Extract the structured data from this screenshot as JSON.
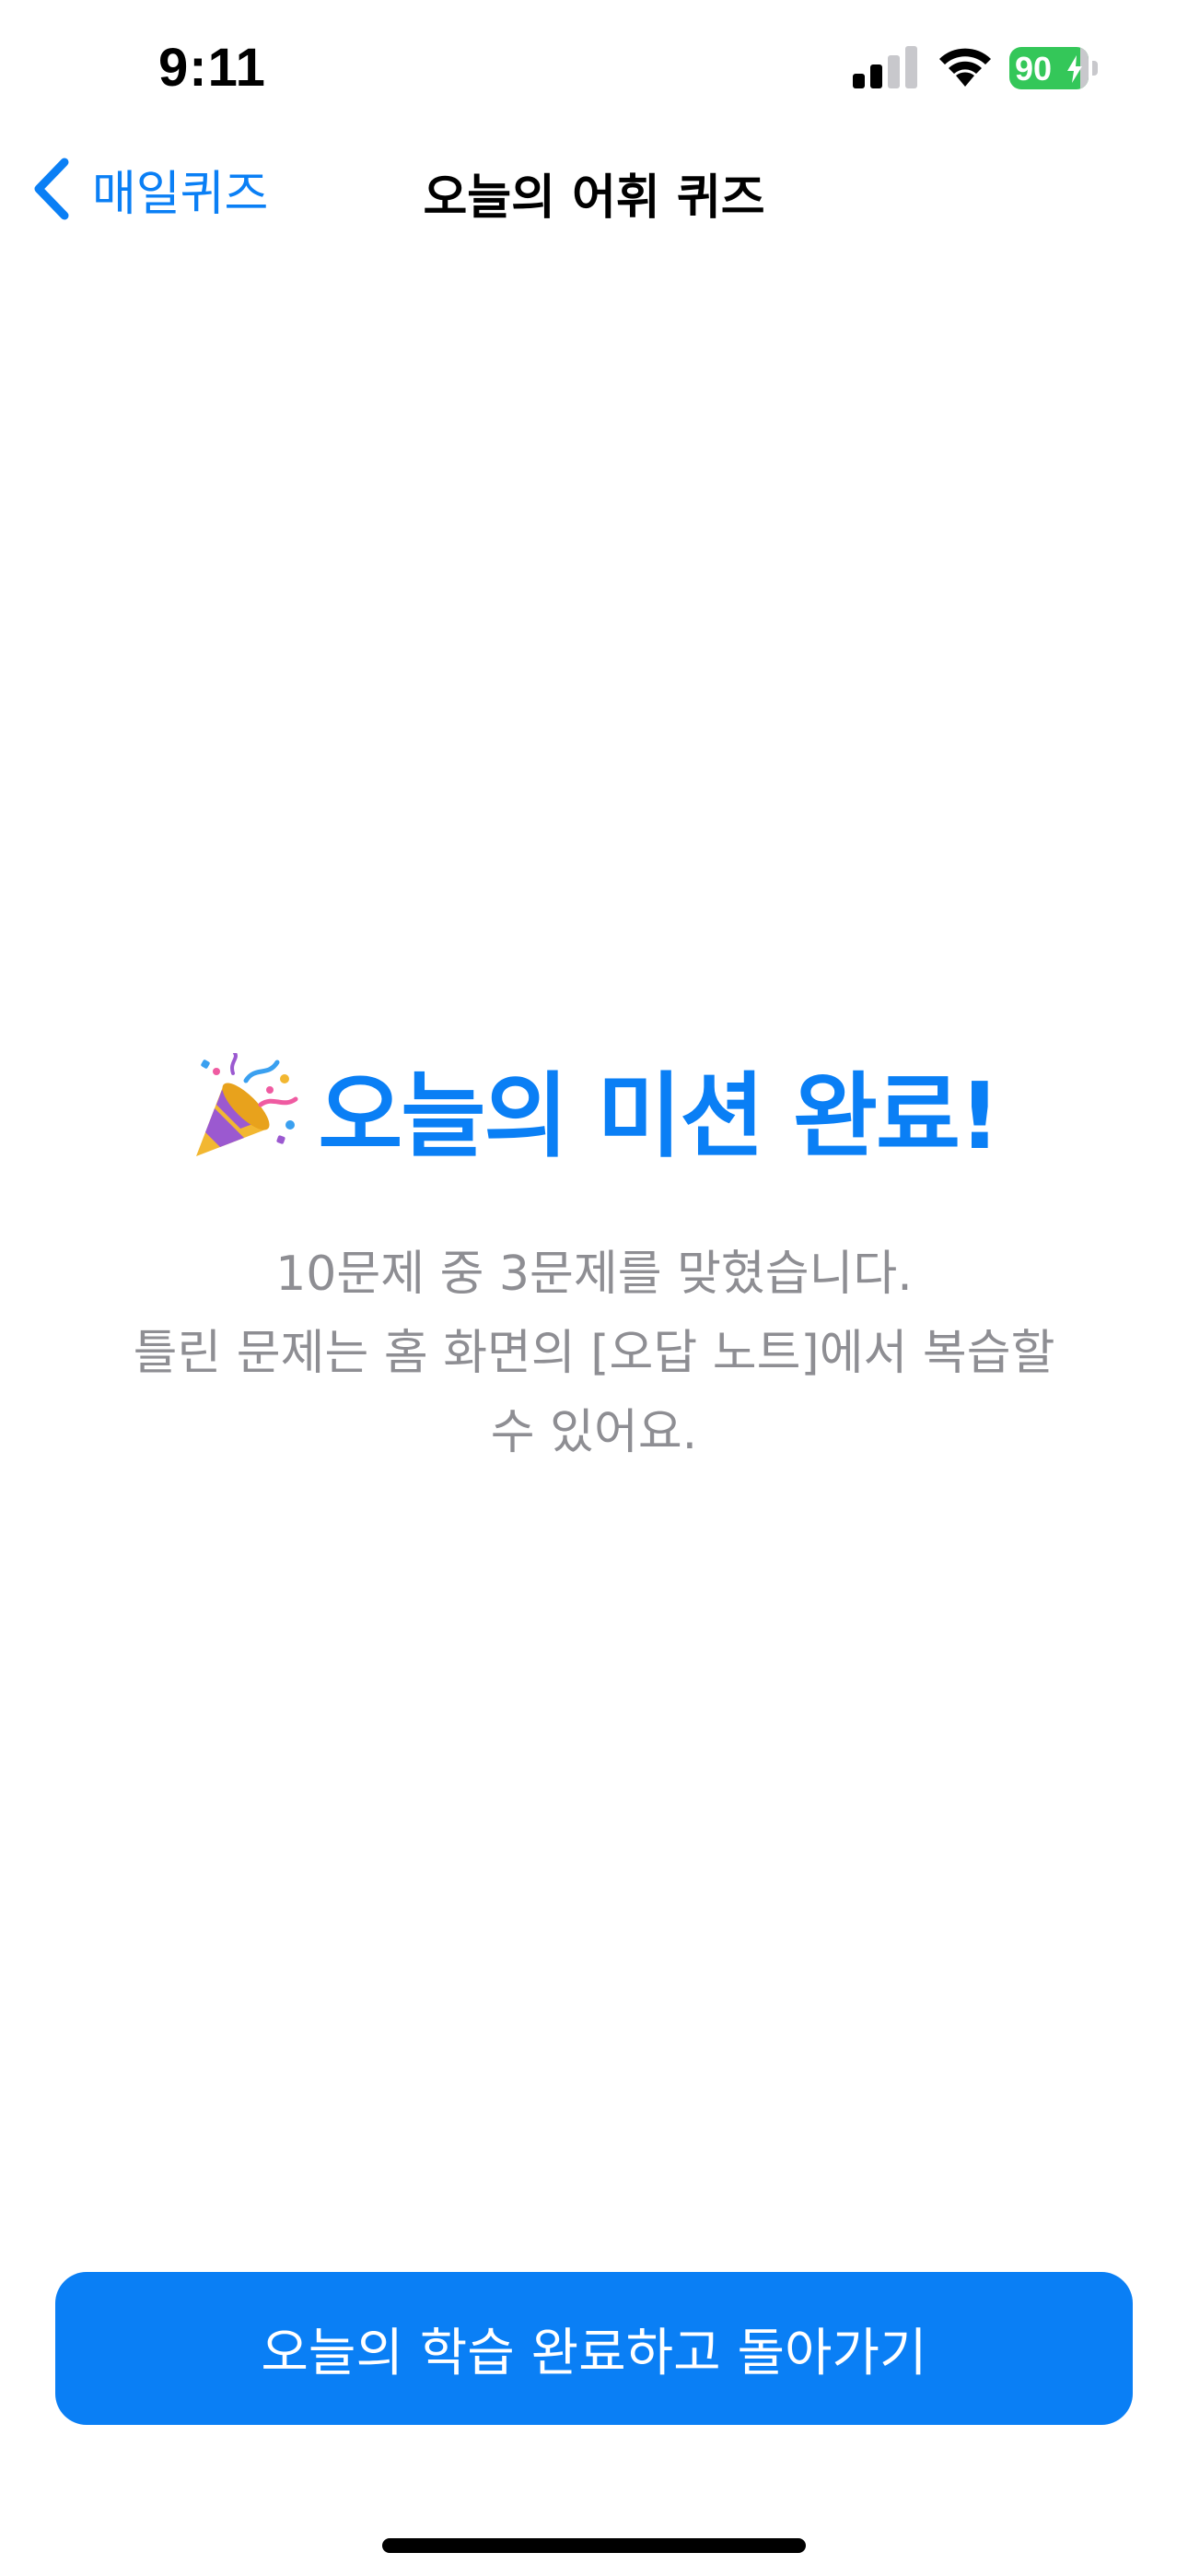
{
  "status_bar": {
    "time": "9:11",
    "battery_level": 90,
    "battery_label": "90",
    "battery_charging": true,
    "signal_bars": 2,
    "icons": [
      "signal-icon",
      "wifi-icon",
      "battery-icon",
      "charging-bolt-icon"
    ]
  },
  "nav": {
    "back_label": "매일퀴즈",
    "title": "오늘의 어휘 퀴즈",
    "icons": [
      "chevron-left-icon"
    ]
  },
  "main": {
    "headline_icon": "party-popper-icon",
    "headline": "오늘의 미션 완료!",
    "message_lines": [
      "10문제 중 3문제를 맞혔습니다.",
      "틀린 문제는 홈 화면의 [오답 노트]에서 복습할",
      "수 있어요."
    ]
  },
  "footer": {
    "primary_button_label": "오늘의 학습 완료하고 돌아가기"
  },
  "colors": {
    "accent": "#0a7ff5",
    "secondary_text": "#8e8e93",
    "battery_green": "#34c759",
    "background": "#ffffff"
  }
}
